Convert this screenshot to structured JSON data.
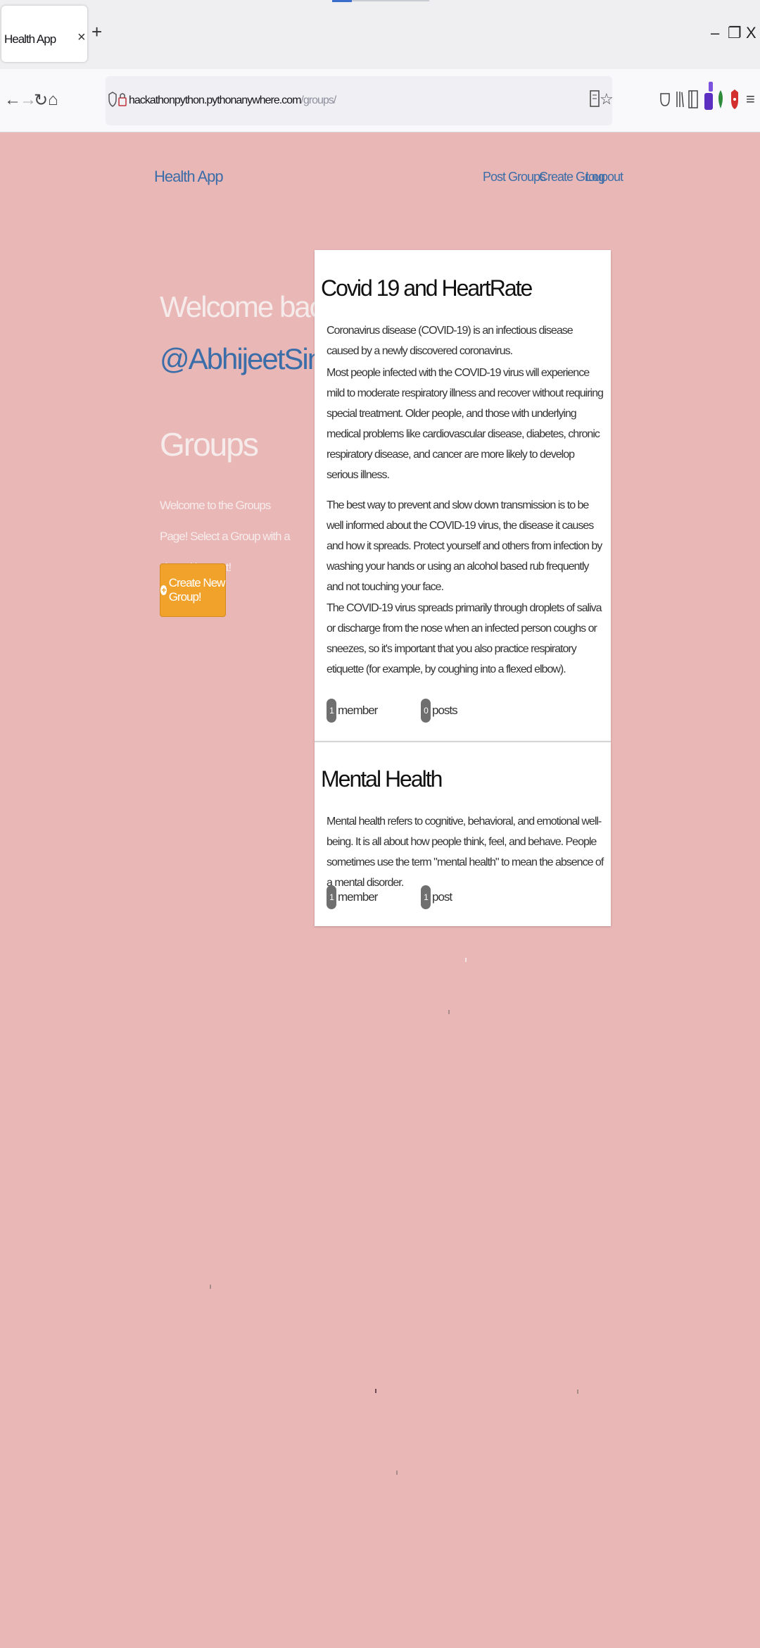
{
  "browser": {
    "tab_title": "Health App",
    "tab_close": "×",
    "new_tab": "+",
    "url_domain": "hackathonpython.pythonanywhere.com",
    "url_path": "/groups/",
    "window_controls": {
      "minimize": "–",
      "restore": "❐",
      "close": "X"
    },
    "nav_icons": {
      "back": "←",
      "forward": "→",
      "reload": "↻",
      "home": "⌂"
    }
  },
  "site": {
    "brand": "Health App",
    "nav": [
      "Post",
      "Groups",
      "Create Group",
      "Log out"
    ]
  },
  "sidebar": {
    "welcome": "Welcome back",
    "username": "@AbhijeetSingh",
    "title": "Groups",
    "intro": "Welcome to the Groups Page! Select a Group with a shared interest!",
    "create_button": "Create New Group!",
    "create_icon": "+"
  },
  "groups": [
    {
      "title": "Covid 19 and HeartRate",
      "paragraphs": [
        "Coronavirus disease (COVID-19) is an infectious disease caused by a newly discovered coronavirus.",
        "Most people infected with the COVID-19 virus will experience mild to moderate respiratory illness and recover without requiring special treatment. Older people, and those with underlying medical problems like cardiovascular disease, diabetes, chronic respiratory disease, and cancer are more likely to develop serious illness.",
        "The best way to prevent and slow down transmission is to be well informed about the COVID-19 virus, the disease it causes and how it spreads. Protect yourself and others from infection by washing your hands or using an alcohol based rub frequently and not touching your face.",
        "The COVID-19 virus spreads primarily through droplets of saliva or discharge from the nose when an infected person coughs or sneezes, so it's important that you also practice respiratory etiquette (for example, by coughing into a flexed elbow)."
      ],
      "member_count": "1",
      "member_label": "member",
      "post_count": "0",
      "post_label": "posts"
    },
    {
      "title": "Mental Health",
      "paragraphs": [
        "Mental health refers to cognitive, behavioral, and emotional well-being. It is all about how people think, feel, and behave. People sometimes use the term \"mental health\" to mean the absence of a mental disorder."
      ],
      "member_count": "1",
      "member_label": "member",
      "post_count": "1",
      "post_label": "post"
    }
  ],
  "colors": {
    "page_background": "#eab7b7",
    "link": "#3b6ea8",
    "button": "#f0a22b"
  }
}
